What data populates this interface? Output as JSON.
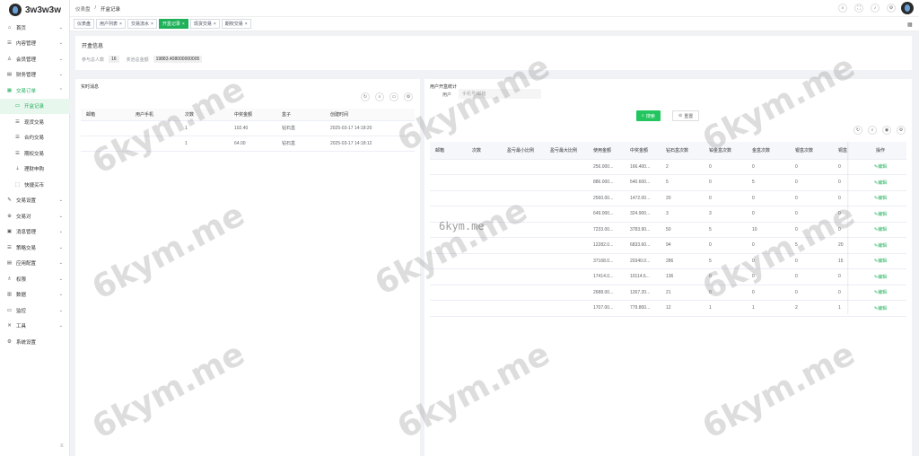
{
  "app": {
    "name": "3w3w3w"
  },
  "sidebar": {
    "items": [
      {
        "icon": "home-icon",
        "glyph": "⌂",
        "label": "首页",
        "arrow": "⌄"
      },
      {
        "icon": "content-icon",
        "glyph": "☰",
        "label": "内容管理",
        "arrow": "⌄"
      },
      {
        "icon": "member-icon",
        "glyph": "♙",
        "label": "会员管理",
        "arrow": "⌄"
      },
      {
        "icon": "finance-icon",
        "glyph": "▤",
        "label": "财务管理",
        "arrow": "⌄"
      },
      {
        "icon": "order-icon",
        "glyph": "▦",
        "label": "交易订单",
        "arrow": "⌃"
      },
      {
        "icon": "box-icon",
        "glyph": "▭",
        "label": "开盒记录",
        "active": true
      },
      {
        "icon": "list-icon",
        "glyph": "☰",
        "label": "现货交易"
      },
      {
        "icon": "list-icon",
        "glyph": "☰",
        "label": "合约交易"
      },
      {
        "icon": "list-icon",
        "glyph": "☰",
        "label": "期权交易"
      },
      {
        "icon": "chart-icon",
        "glyph": "⇣",
        "label": "理财申购"
      },
      {
        "icon": "cart-icon",
        "glyph": "⬚",
        "label": "快捷买币"
      },
      {
        "icon": "settings-icon",
        "glyph": "✎",
        "label": "交易设置",
        "arrow": "⌄"
      },
      {
        "icon": "exchange-icon",
        "glyph": "⊕",
        "label": "交易对",
        "arrow": "⌄"
      },
      {
        "icon": "message-icon",
        "glyph": "▣",
        "label": "消息管理",
        "arrow": "⌄"
      },
      {
        "icon": "strategy-icon",
        "glyph": "☰",
        "label": "策略交易",
        "arrow": "⌄"
      },
      {
        "icon": "app-icon",
        "glyph": "▤",
        "label": "应用配置",
        "arrow": "⌄"
      },
      {
        "icon": "permission-icon",
        "glyph": "♗",
        "label": "权限",
        "arrow": "⌄"
      },
      {
        "icon": "data-icon",
        "glyph": "▥",
        "label": "数据",
        "arrow": "⌄"
      },
      {
        "icon": "monitor-icon",
        "glyph": "▭",
        "label": "监控",
        "arrow": "⌄"
      },
      {
        "icon": "tool-icon",
        "glyph": "✕",
        "label": "工具",
        "arrow": "⌄"
      },
      {
        "icon": "system-icon",
        "glyph": "⚙",
        "label": "系统设置"
      }
    ],
    "collapse_glyph": "≡"
  },
  "header": {
    "breadcrumb": [
      "仪表盘",
      "/",
      "开盒记录"
    ]
  },
  "tabs": [
    {
      "label": "仪表盘",
      "closable": false
    },
    {
      "label": "用户列表",
      "closable": true
    },
    {
      "label": "交易流水",
      "closable": true
    },
    {
      "label": "开盒记录",
      "closable": true,
      "active": true
    },
    {
      "label": "现货交易",
      "closable": true
    },
    {
      "label": "期权交易",
      "closable": true
    }
  ],
  "summary": {
    "title": "开盒信息",
    "participants_label": "参与总人数",
    "participants_value": "16",
    "payout_label": "奖池总金额",
    "payout_value": "19883.408000000005"
  },
  "realtime": {
    "title": "实时消息",
    "columns": [
      "邮箱",
      "用户手机",
      "次数",
      "中奖金额",
      "盒子",
      "创建时间"
    ],
    "rows": [
      [
        "",
        "",
        "1",
        "102.40",
        "钻石盒",
        "2025-03-17 14:18:20"
      ],
      [
        "",
        "",
        "1",
        "64.00",
        "钻石盒",
        "2025-03-17 14:18:12"
      ]
    ]
  },
  "stats": {
    "title": "用户开盒统计",
    "filter_label": "用户",
    "filter_placeholder": "手机号/邮箱",
    "search_label": "搜索",
    "reset_label": "重置",
    "columns": [
      "邮箱",
      "次数",
      "盈亏最小比例",
      "盈亏最大比例",
      "使用金额",
      "中奖金额",
      "钻石盒次数",
      "铂金盒次数",
      "金盒次数",
      "银盒次数",
      "铜盒",
      "操作"
    ],
    "edit_label": "编辑",
    "rows": [
      [
        "256.000...",
        "166.400...",
        "2",
        "0",
        "0",
        "0",
        "0"
      ],
      [
        "886.000...",
        "540.600...",
        "5",
        "0",
        "5",
        "0",
        "0"
      ],
      [
        "2560.00...",
        "1472.00...",
        "20",
        "0",
        "0",
        "0",
        "0"
      ],
      [
        "649.000...",
        "324.900...",
        "3",
        "3",
        "0",
        "0",
        "0"
      ],
      [
        "7233.00...",
        "3783.90...",
        "50",
        "5",
        "10",
        "0",
        "0"
      ],
      [
        "12282.0...",
        "6833.60...",
        "94",
        "0",
        "0",
        "5",
        "20"
      ],
      [
        "37168.0...",
        "20340.0...",
        "286",
        "5",
        "0",
        "0",
        "15"
      ],
      [
        "17414.0...",
        "10114.6...",
        "136",
        "0",
        "0",
        "0",
        "0"
      ],
      [
        "2688.00...",
        "1267.20...",
        "21",
        "0",
        "0",
        "0",
        "0"
      ],
      [
        "1707.00...",
        "779.800...",
        "12",
        "1",
        "1",
        "2",
        "1"
      ]
    ]
  },
  "watermark": {
    "text": "6kym.me",
    "small_text": "6kym.me"
  }
}
